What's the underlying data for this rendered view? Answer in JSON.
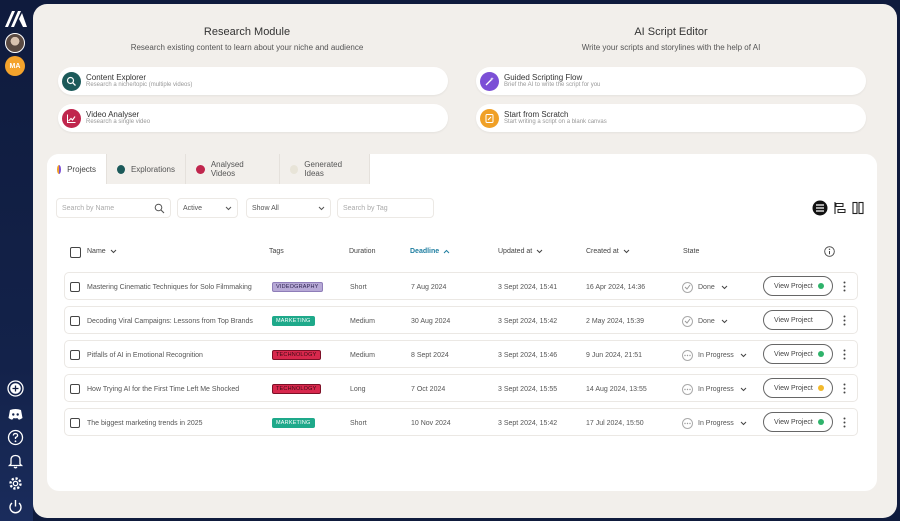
{
  "sidebar": {
    "avatar_initials": "MA"
  },
  "research": {
    "title": "Research Module",
    "subtitle": "Research existing content to learn about your niche and audience",
    "cards": [
      {
        "title": "Content Explorer",
        "subtitle": "Research a niche/topic (multiple videos)"
      },
      {
        "title": "Video Analyser",
        "subtitle": "Research a single video"
      }
    ]
  },
  "script_editor": {
    "title": "AI Script Editor",
    "subtitle": "Write your scripts and storylines with the help of AI",
    "cards": [
      {
        "title": "Guided Scripting Flow",
        "subtitle": "Brief the AI to write the script for you"
      },
      {
        "title": "Start from Scratch",
        "subtitle": "Start writing a script on a blank canvas"
      }
    ]
  },
  "tabs": [
    {
      "label": "Projects",
      "color": "#7b4fd6"
    },
    {
      "label": "Explorations",
      "color": "#1c5a5a"
    },
    {
      "label": "Analysed Videos",
      "color": "#c0264d"
    },
    {
      "label": "Generated Ideas",
      "color": "#e8e4d8"
    }
  ],
  "filters": {
    "search_name_placeholder": "Search by Name",
    "status_value": "Active",
    "show_value": "Show All",
    "search_tag_placeholder": "Search by Tag"
  },
  "columns": {
    "name": "Name",
    "tags": "Tags",
    "duration": "Duration",
    "deadline": "Deadline",
    "updated": "Updated at",
    "created": "Created at",
    "state": "State"
  },
  "rows": [
    {
      "name": "Mastering Cinematic Techniques for Solo Filmmaking",
      "tag": "VIDEOGRAPHY",
      "duration": "Short",
      "deadline": "7 Aug 2024",
      "updated": "3 Sept 2024, 15:41",
      "created": "16 Apr 2024, 14:36",
      "state": "Done",
      "button": "View Project",
      "dot_color": "#2fb36b"
    },
    {
      "name": "Decoding Viral Campaigns: Lessons from Top Brands",
      "tag": "MARKETING",
      "duration": "Medium",
      "deadline": "30 Aug 2024",
      "updated": "3 Sept 2024, 15:42",
      "created": "2 May 2024, 15:39",
      "state": "Done",
      "button": "View Project",
      "dot_color": ""
    },
    {
      "name": "Pitfalls of AI in Emotional Recognition",
      "tag": "TECHNOLOGY",
      "duration": "Medium",
      "deadline": "8 Sept 2024",
      "updated": "3 Sept 2024, 15:46",
      "created": "9 Jun 2024, 21:51",
      "state": "In Progress",
      "button": "View Project",
      "dot_color": "#2fb36b"
    },
    {
      "name": "How Trying AI for the First Time Left Me Shocked",
      "tag": "TECHNOLOGY",
      "duration": "Long",
      "deadline": "7 Oct 2024",
      "updated": "3 Sept 2024, 15:55",
      "created": "14 Aug 2024, 13:55",
      "state": "In Progress",
      "button": "View Project",
      "dot_color": "#f2b92c"
    },
    {
      "name": "The biggest marketing trends in 2025",
      "tag": "MARKETING",
      "duration": "Short",
      "deadline": "10 Nov 2024",
      "updated": "3 Sept 2024, 15:42",
      "created": "17 Jul 2024, 15:50",
      "state": "In Progress",
      "button": "View Project",
      "dot_color": "#2fb36b"
    }
  ]
}
